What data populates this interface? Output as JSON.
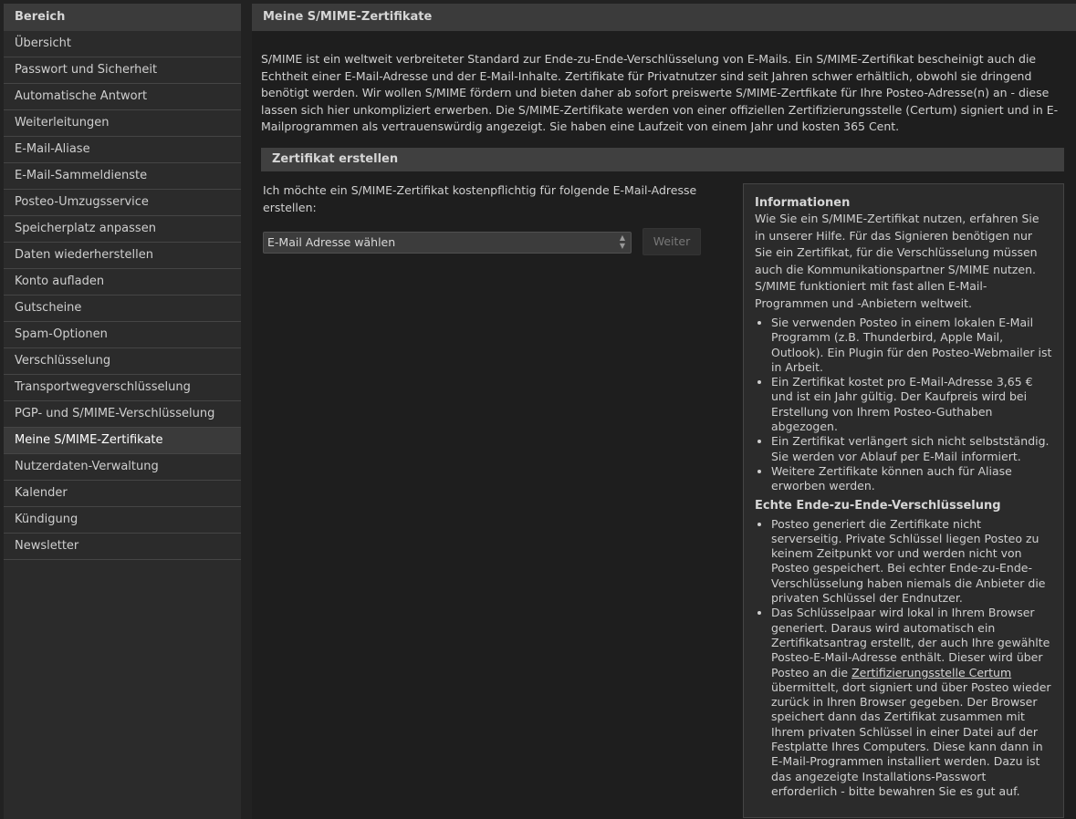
{
  "sidebar": {
    "title": "Bereich",
    "items": [
      {
        "label": "Übersicht"
      },
      {
        "label": "Passwort und Sicherheit"
      },
      {
        "label": "Automatische Antwort"
      },
      {
        "label": "Weiterleitungen"
      },
      {
        "label": "E-Mail-Aliase"
      },
      {
        "label": "E-Mail-Sammeldienste"
      },
      {
        "label": "Posteo-Umzugsservice"
      },
      {
        "label": "Speicherplatz anpassen"
      },
      {
        "label": "Daten wiederherstellen"
      },
      {
        "label": "Konto aufladen"
      },
      {
        "label": "Gutscheine"
      },
      {
        "label": "Spam-Optionen"
      },
      {
        "label": "Verschlüsselung"
      },
      {
        "label": "Transportwegverschlüsselung"
      },
      {
        "label": "PGP- und S/MIME-Verschlüsselung"
      },
      {
        "label": "Meine S/MIME-Zertifikate",
        "active": true
      },
      {
        "label": "Nutzerdaten-Verwaltung"
      },
      {
        "label": "Kalender"
      },
      {
        "label": "Kündigung"
      },
      {
        "label": "Newsletter"
      }
    ]
  },
  "main": {
    "title": "Meine S/MIME-Zertifikate",
    "intro": "S/MIME ist ein weltweit verbreiteter Standard zur Ende-zu-Ende-Verschlüsselung von E-Mails. Ein S/MIME-Zertifikat bescheinigt auch die Echtheit einer E-Mail-Adresse und der E-Mail-Inhalte. Zertifikate für Privatnutzer sind seit Jahren schwer erhältlich, obwohl sie dringend benötigt werden. Wir wollen S/MIME fördern und bieten daher ab sofort preiswerte S/MIME-Zertfikate für Ihre Posteo-Adresse(n) an - diese lassen sich hier unkompliziert erwerben. Die S/MIME-Zertifikate werden von einer offiziellen Zertifizierungsstelle (Certum) signiert und in E-Mailprogrammen als vertrauenswürdig angezeigt. Sie haben eine Laufzeit von einem Jahr und kosten 365 Cent.",
    "section_title": "Zertifikat erstellen",
    "request_text": "Ich möchte ein S/MIME-Zertifikat kostenpflichtig für folgende E-Mail-Adresse erstellen:",
    "select_value": "E-Mail Adresse wählen",
    "next_label": "Weiter"
  },
  "info": {
    "heading": "Informationen",
    "text": "Wie Sie ein S/MIME-Zertifikat nutzen, erfahren Sie in unserer Hilfe. Für das Signieren benötigen nur Sie ein Zertifikat, für die Verschlüsselung müssen auch die Kommunikationspartner S/MIME nutzen. S/MIME funktioniert mit fast allen E-Mail-Programmen und -Anbietern weltweit.",
    "bullets": [
      "Sie verwenden Posteo in einem lokalen E-Mail Programm (z.B. Thunderbird, Apple Mail, Outlook). Ein Plugin für den Posteo-Webmailer ist in Arbeit.",
      "Ein Zertifikat kostet pro E-Mail-Adresse 3,65 € und ist ein Jahr gültig. Der Kaufpreis wird bei Erstellung von Ihrem Posteo-Guthaben abgezogen.",
      "Ein Zertifikat verlängert sich nicht selbstständig. Sie werden vor Ablauf per E-Mail informiert.",
      "Weitere Zertifikate können auch für Aliase erworben werden."
    ],
    "heading2": "Echte Ende-zu-Ende-Verschlüsselung",
    "e2e_bullet1": "Posteo generiert die Zertifikate nicht serverseitig. Private Schlüssel liegen Posteo zu keinem Zeitpunkt vor und werden nicht von Posteo gespeichert. Bei echter Ende-zu-Ende-Verschlüsselung haben niemals die Anbieter die privaten Schlüssel der Endnutzer.",
    "e2e_bullet2_before": "Das Schlüsselpaar wird lokal in Ihrem Browser generiert. Daraus wird automatisch ein Zertifikatsantrag erstellt, der auch Ihre gewählte Posteo-E-Mail-Adresse enthält. Dieser wird über Posteo an die ",
    "e2e_bullet2_link": "Zertifizierungsstelle Certum",
    "e2e_bullet2_after": " übermittelt, dort signiert und über Posteo wieder zurück in Ihren Browser gegeben. Der Browser speichert dann das Zertifikat zusammen mit Ihrem privaten Schlüssel in einer Datei auf der Festplatte Ihres Computers. Diese kann dann in E-Mail-Programmen installiert werden. Dazu ist das angezeigte Installations-Passwort erforderlich - bitte bewahren Sie es gut auf."
  },
  "icons": {
    "select_arrows": "select-arrows-icon"
  }
}
